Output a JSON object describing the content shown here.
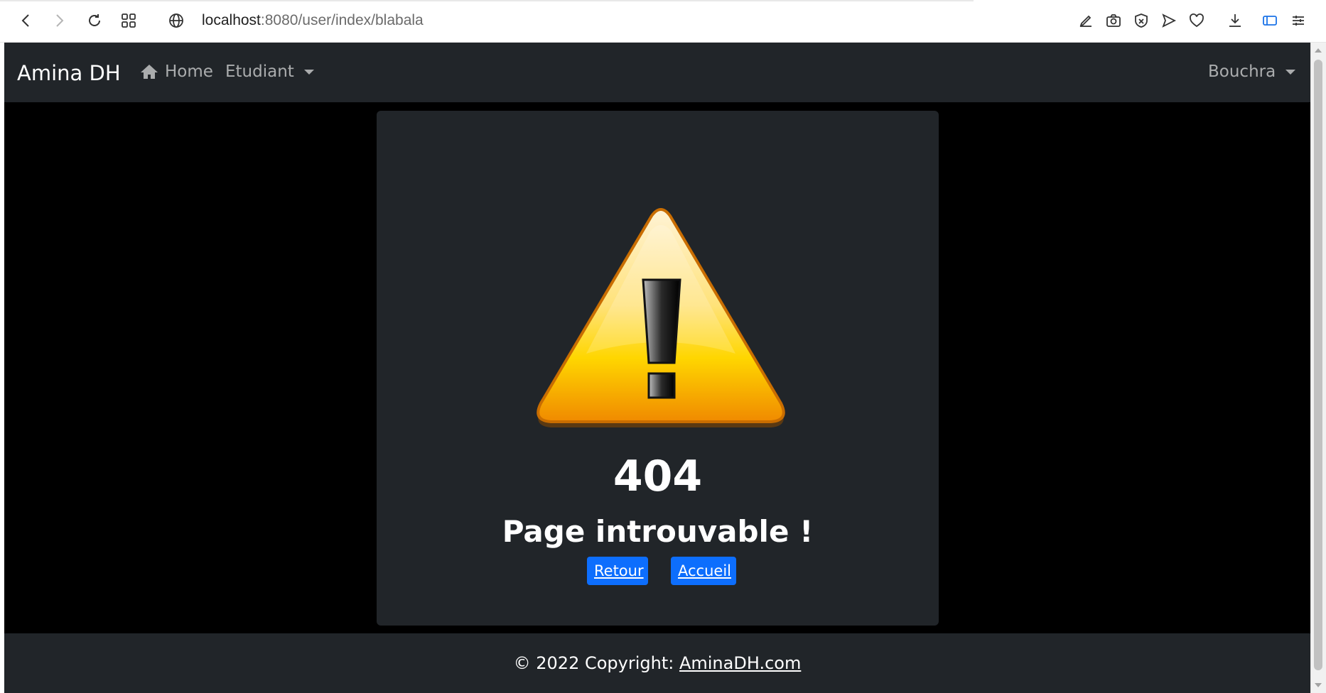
{
  "browser": {
    "url_host": "localhost",
    "url_rest": ":8080/user/index/blabala",
    "toolbar_icons": [
      "back-icon",
      "forward-icon",
      "reload-icon",
      "grid-icon",
      "globe-icon",
      "edit-icon",
      "camera-icon",
      "shield-icon",
      "send-icon",
      "heart-icon",
      "download-icon",
      "sidebar-icon",
      "menu-icon"
    ]
  },
  "navbar": {
    "brand": "Amina DH",
    "home_label": "Home",
    "dropdown_label": "Etudiant",
    "user_label": "Bouchra"
  },
  "card": {
    "code": "404",
    "message": "Page introuvable !",
    "back_button": "Retour",
    "home_button": "Accueil"
  },
  "footer": {
    "prefix": "© 2022 Copyright: ",
    "link": "AminaDH.com"
  },
  "colors": {
    "navbar_bg": "#212529",
    "page_bg": "#000000",
    "button_blue": "#0d6efd",
    "warning_orange": "#f5a000"
  }
}
